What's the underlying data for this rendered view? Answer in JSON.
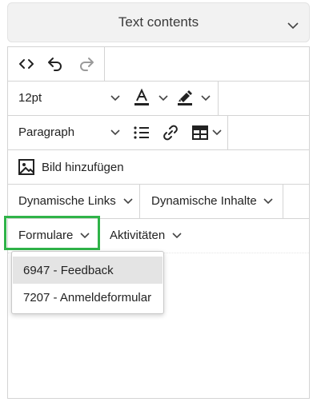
{
  "panel": {
    "title": "Text contents"
  },
  "toolbar": {
    "font_size": "12pt",
    "block_format": "Paragraph",
    "add_image_label": "Bild hinzufügen",
    "dynamic_links_label": "Dynamische Links",
    "dynamic_content_label": "Dynamische Inhalte",
    "forms_label": "Formulare",
    "activities_label": "Aktivitäten"
  },
  "forms_menu": {
    "items": [
      {
        "label": "6947 - Feedback",
        "highlighted": true
      },
      {
        "label": "7207 - Anmeldeformular",
        "highlighted": false
      }
    ]
  },
  "colors": {
    "focus_outline": "#2fb348",
    "menu_highlight": "#e4e4e4"
  }
}
